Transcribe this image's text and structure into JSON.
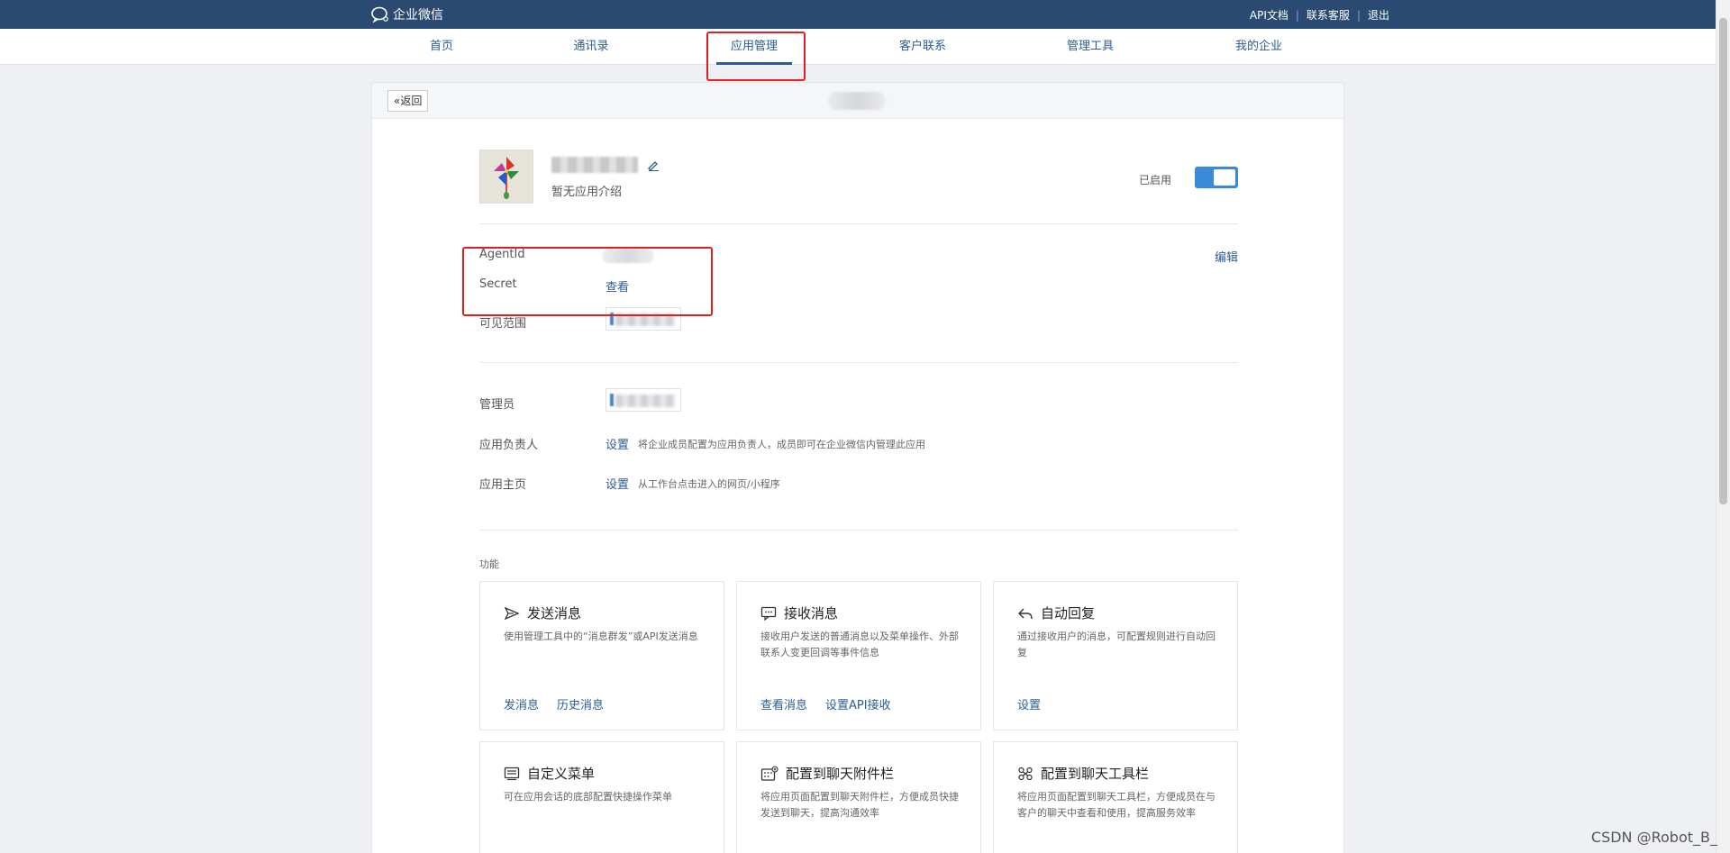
{
  "topbar": {
    "brand": "企业微信",
    "links": [
      "API文档",
      "联系客服",
      "退出"
    ]
  },
  "nav": {
    "items": [
      "首页",
      "通讯录",
      "应用管理",
      "客户联系",
      "管理工具",
      "我的企业"
    ],
    "active": "应用管理"
  },
  "card": {
    "back_label": "«返回"
  },
  "app": {
    "description": "暂无应用介绍",
    "enabled_label": "已启用",
    "enabled": true
  },
  "credentials": {
    "agentid_label": "AgentId",
    "secret_label": "Secret",
    "secret_link": "查看",
    "edit_link": "编辑",
    "scope_label": "可见范围"
  },
  "settings": {
    "admin_label": "管理员",
    "owner_label": "应用负责人",
    "owner_link": "设置",
    "owner_desc": "将企业成员配置为应用负责人，成员即可在企业微信内管理此应用",
    "home_label": "应用主页",
    "home_link": "设置",
    "home_desc": "从工作台点击进入的网页/小程序"
  },
  "features": {
    "section_title": "功能",
    "cards": [
      {
        "icon": "send-icon",
        "title": "发送消息",
        "desc": "使用管理工具中的“消息群发”或API发送消息",
        "actions": [
          "发消息",
          "历史消息"
        ]
      },
      {
        "icon": "chat-icon",
        "title": "接收消息",
        "desc": "接收用户发送的普通消息以及菜单操作、外部联系人变更回调等事件信息",
        "actions": [
          "查看消息",
          "设置API接收"
        ]
      },
      {
        "icon": "reply-icon",
        "title": "自动回复",
        "desc": "通过接收用户的消息，可配置规则进行自动回复",
        "actions": [
          "设置"
        ]
      },
      {
        "icon": "menu-icon",
        "title": "自定义菜单",
        "desc": "可在应用会话的底部配置快捷操作菜单",
        "actions": []
      },
      {
        "icon": "attachment-icon",
        "title": "配置到聊天附件栏",
        "desc": "将应用页面配置到聊天附件栏，方便成员快捷发送到聊天，提高沟通效率",
        "actions": []
      },
      {
        "icon": "toolbar-icon",
        "title": "配置到聊天工具栏",
        "desc": "将应用页面配置到聊天工具栏，方便成员在与客户的聊天中查看和使用，提高服务效率",
        "actions": []
      }
    ]
  },
  "watermark": "CSDN @Robot_B_"
}
